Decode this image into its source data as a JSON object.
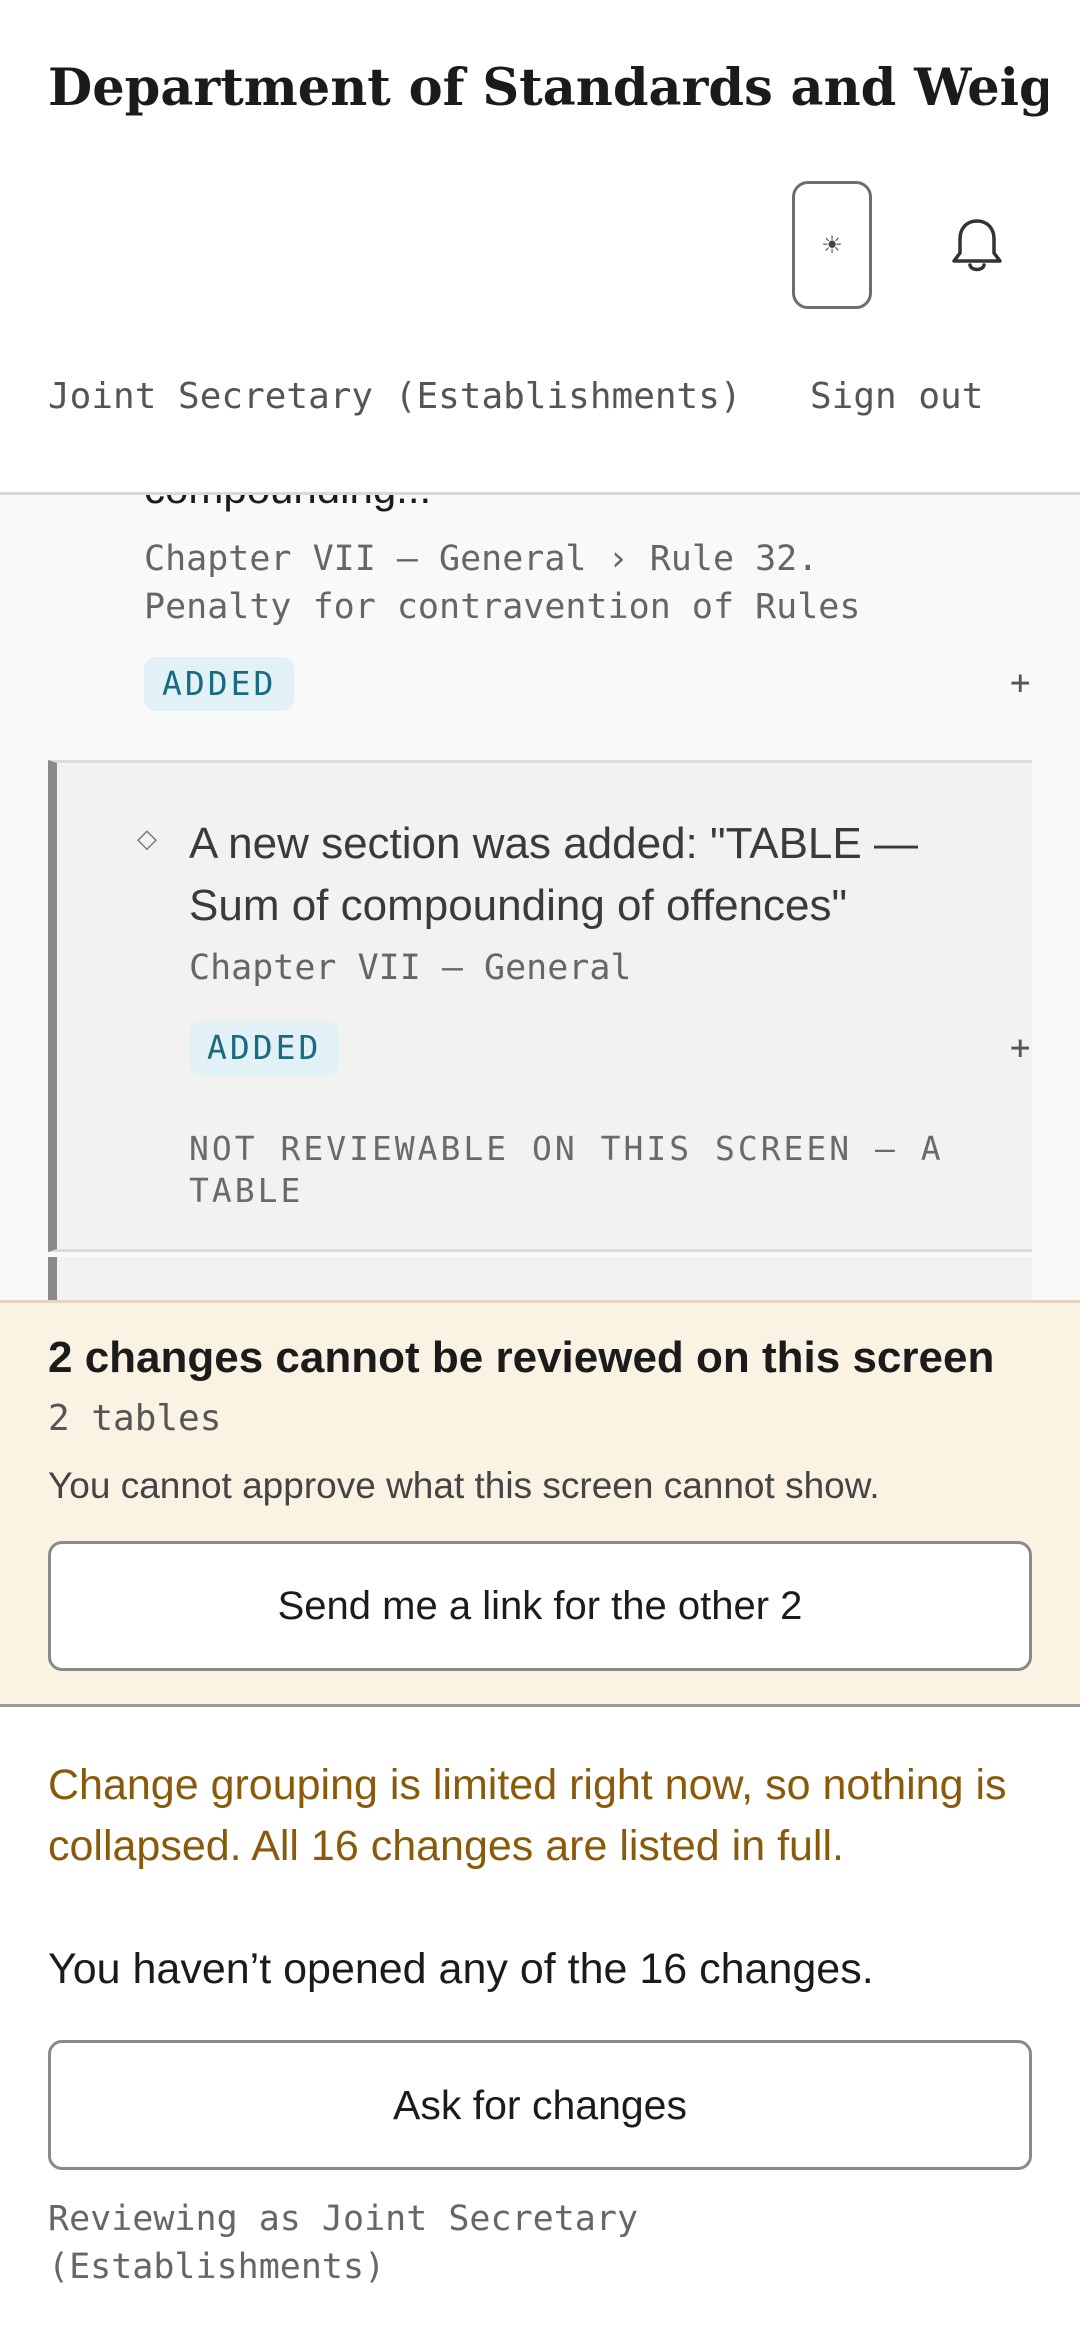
{
  "header": {
    "title": "Department of Standards and Weights",
    "theme_toggle_glyph": "☀",
    "user_role": "Joint Secretary (Establishments)",
    "sign_out": "Sign out"
  },
  "list": {
    "prev_item": {
      "title_fragment": "compounding...",
      "path": "Chapter VII — General › Rule 32. Penalty for contravention of Rules",
      "badge": "ADDED",
      "expand": "+"
    },
    "item": {
      "marker": "◇",
      "title": "A new section was added: \"TABLE — Sum of compounding of offences\"",
      "path": "Chapter VII — General",
      "badge": "ADDED",
      "expand": "+",
      "note": "NOT REVIEWABLE ON THIS SCREEN — A TABLE"
    }
  },
  "warning": {
    "title": "2 changes cannot be reviewed on this screen",
    "subtitle": "2 tables",
    "body": "You cannot approve what this screen cannot show.",
    "button": "Send me a link for the other 2"
  },
  "footer": {
    "notice": "Change grouping is limited right now, so nothing is collapsed. All 16 changes are listed in full.",
    "opened_status": "You haven’t opened any of the 16 changes.",
    "ask_button": "Ask for changes",
    "reviewing_as": "Reviewing as Joint Secretary (Establishments)"
  },
  "colors": {
    "badge_bg": "#e2f1f5",
    "badge_text": "#1a6a80",
    "warning_bg": "#faf2e2",
    "notice_text": "#8a5a0b"
  },
  "icons": {
    "theme": "sun-icon",
    "notifications": "bell-icon"
  }
}
